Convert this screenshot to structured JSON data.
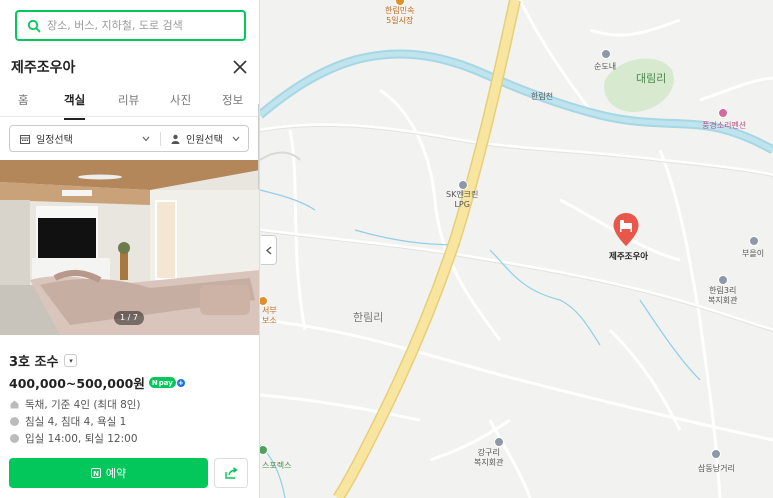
{
  "search": {
    "placeholder": "장소, 버스, 지하철, 도로 검색"
  },
  "place": {
    "name": "제주조우아"
  },
  "tabs": [
    {
      "label": "홈"
    },
    {
      "label": "객실"
    },
    {
      "label": "리뷰"
    },
    {
      "label": "사진"
    },
    {
      "label": "정보"
    }
  ],
  "active_tab": "객실",
  "filters": {
    "date_label": "일정선택",
    "guests_label": "인원선택"
  },
  "photo": {
    "counter": "1 / 7"
  },
  "room": {
    "name": "3호 조수",
    "price": "400,000~500,000원",
    "npay_label": "pay",
    "details": [
      "독채, 기준 4인 (최대 8인)",
      "침실 4, 침대 4, 욕실 1",
      "입실 14:00, 퇴실 12:00"
    ]
  },
  "actions": {
    "reserve_label": "예약"
  },
  "map": {
    "labels": {
      "market": "한림민속\n5일시장",
      "sundonae": "순도내",
      "daerimri": "대림리",
      "hallimcheon": "한림천",
      "pension": "풍경소리펜션",
      "sk": "SK엔크린\nLPG",
      "marker": "제주조우아",
      "bureum": "부을이",
      "hallim3": "한림3리\n복지회관",
      "hallimri": "한림리",
      "seobu": "서부\n보소",
      "gangguri": "강구리\n복지회관",
      "sports": "스포렉스",
      "samdong": "삼동낭거리"
    }
  },
  "colors": {
    "accent": "#03c75a",
    "marker": "#e8574a",
    "river": "#b7e0e8",
    "highway": "#f6e08c"
  }
}
